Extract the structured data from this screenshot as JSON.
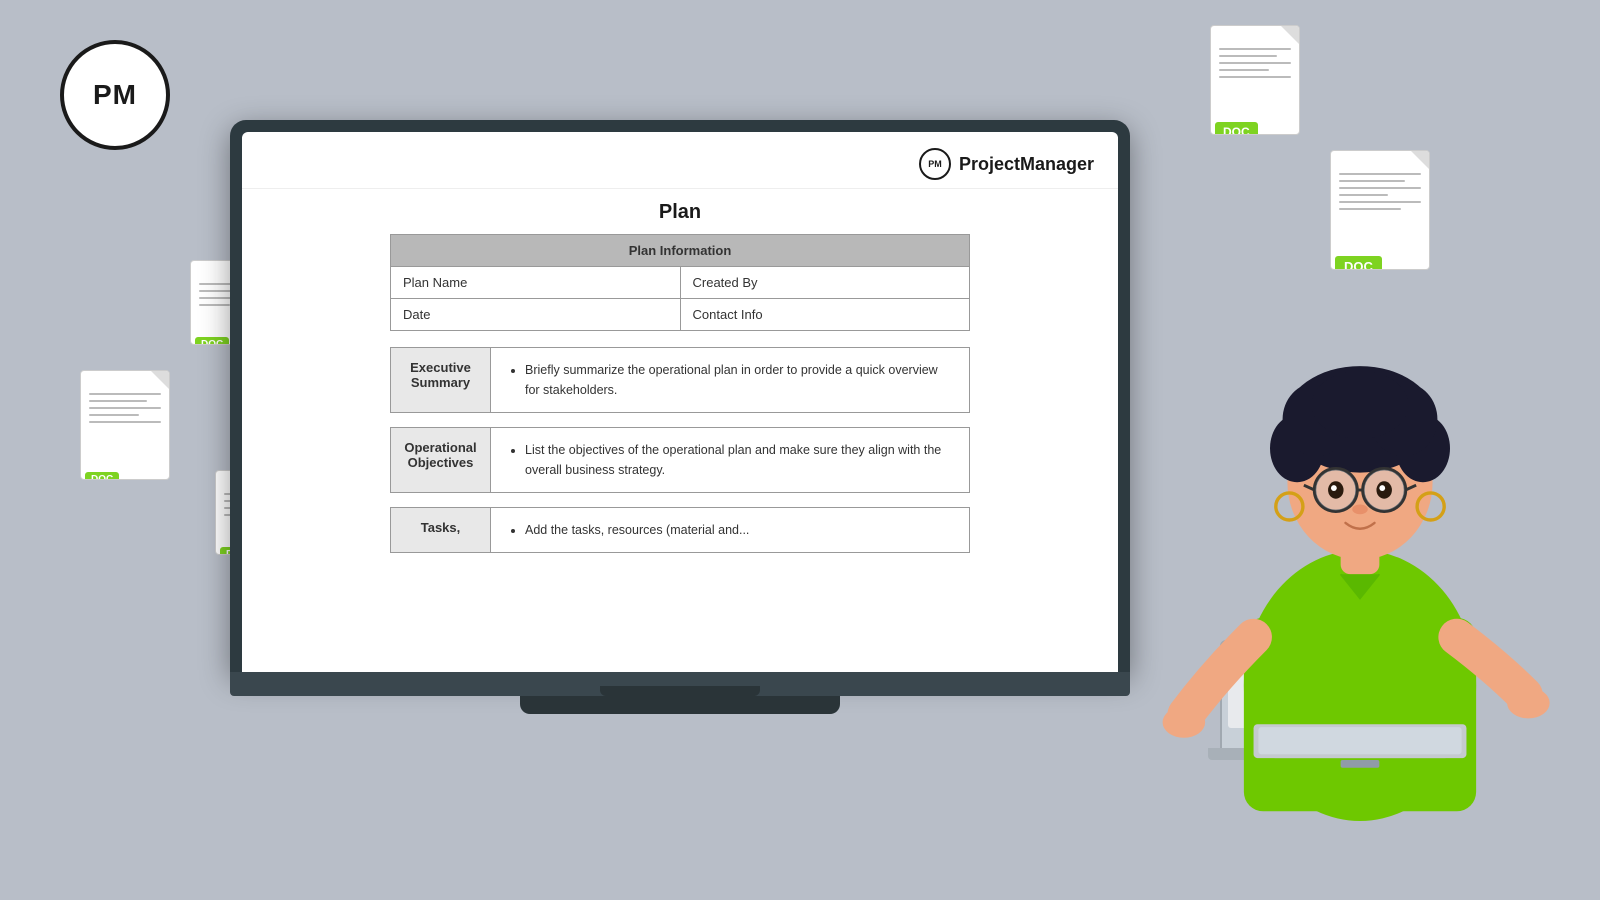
{
  "brand": {
    "logo_text": "PM",
    "name": "ProjectManager"
  },
  "floating_docs": [
    {
      "id": "doc-top-right",
      "label": "DOC",
      "size": "large"
    },
    {
      "id": "doc-right-mid",
      "label": "DOC",
      "size": "xlarge"
    },
    {
      "id": "doc-left-top",
      "label": "DOC",
      "size": "medium"
    },
    {
      "id": "doc-left-mid",
      "label": "DOC",
      "size": "large"
    },
    {
      "id": "doc-left-bot",
      "label": "DOC",
      "size": "medium"
    }
  ],
  "document": {
    "title": "Plan",
    "plan_information": {
      "header": "Plan Information",
      "row1_col1_label": "Plan Name",
      "row1_col2_label": "Created By",
      "row2_col1_label": "Date",
      "row2_col2_label": "Contact Info"
    },
    "sections": [
      {
        "label": "Executive\nSummary",
        "content": "Briefly summarize the operational plan in order to provide a quick overview for stakeholders."
      },
      {
        "label": "Operational\nObjectives",
        "content": "List the objectives of the operational plan and make sure they align with the overall business strategy."
      },
      {
        "label": "Tasks,",
        "content": "Add the tasks, resources (material and..."
      }
    ]
  },
  "colors": {
    "background": "#b8bec8",
    "accent_green": "#7ed321",
    "laptop_dark": "#2d3a40",
    "doc_badge_bg": "#7ed321"
  }
}
